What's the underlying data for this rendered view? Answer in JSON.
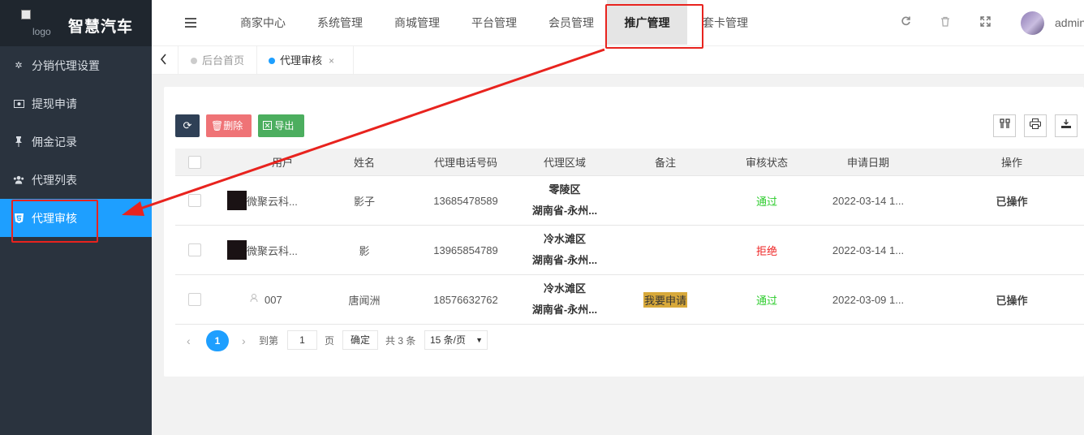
{
  "sidebar": {
    "logo_alt": "logo",
    "app_title": "智慧汽车",
    "items": [
      {
        "label": "分销代理设置",
        "icon": "gear-icon"
      },
      {
        "label": "提现申请",
        "icon": "money-icon"
      },
      {
        "label": "佣金记录",
        "icon": "pin-icon"
      },
      {
        "label": "代理列表",
        "icon": "users-icon"
      },
      {
        "label": "代理审核",
        "icon": "html5-icon",
        "active": true
      }
    ]
  },
  "header": {
    "nav": [
      "商家中心",
      "系统管理",
      "商城管理",
      "平台管理",
      "会员管理",
      "推广管理",
      "套卡管理"
    ],
    "active_nav": "推广管理",
    "user": "admin"
  },
  "tabs": [
    {
      "label": "后台首页",
      "active": false
    },
    {
      "label": "代理审核",
      "active": true,
      "close": "×"
    }
  ],
  "toolbar": {
    "refresh_icon": "⟳",
    "delete_label": "删除",
    "export_label": "导出"
  },
  "table": {
    "columns": [
      "用户",
      "姓名",
      "代理电话号码",
      "代理区域",
      "备注",
      "审核状态",
      "申请日期",
      "操作"
    ],
    "rows": [
      {
        "user": "微聚云科...",
        "name": "影子",
        "phone": "13685478589",
        "region1": "零陵区",
        "region2": "湖南省-永州...",
        "remark": "",
        "status": "通过",
        "date": "2022-03-14 1...",
        "op": "已操作"
      },
      {
        "user": "微聚云科...",
        "name": "影",
        "phone": "13965854789",
        "region1": "冷水滩区",
        "region2": "湖南省-永州...",
        "remark": "",
        "status": "拒绝",
        "date": "2022-03-14 1...",
        "op": ""
      },
      {
        "user": "007",
        "name": "唐闻洲",
        "phone": "18576632762",
        "region1": "冷水滩区",
        "region2": "湖南省-永州...",
        "remark": "我要申请",
        "status": "通过",
        "date": "2022-03-09 1...",
        "op": "已操作"
      }
    ]
  },
  "pager": {
    "current": "1",
    "goto_label": "到第",
    "page_value": "1",
    "page_unit": "页",
    "confirm": "确定",
    "total": "共 3 条",
    "page_size": "15 条/页"
  },
  "colors": {
    "accent": "#1e9fff",
    "sidebar": "#2a333e",
    "annotation": "#e8231e",
    "pass": "#2ecc2e",
    "reject": "#ee2222"
  }
}
